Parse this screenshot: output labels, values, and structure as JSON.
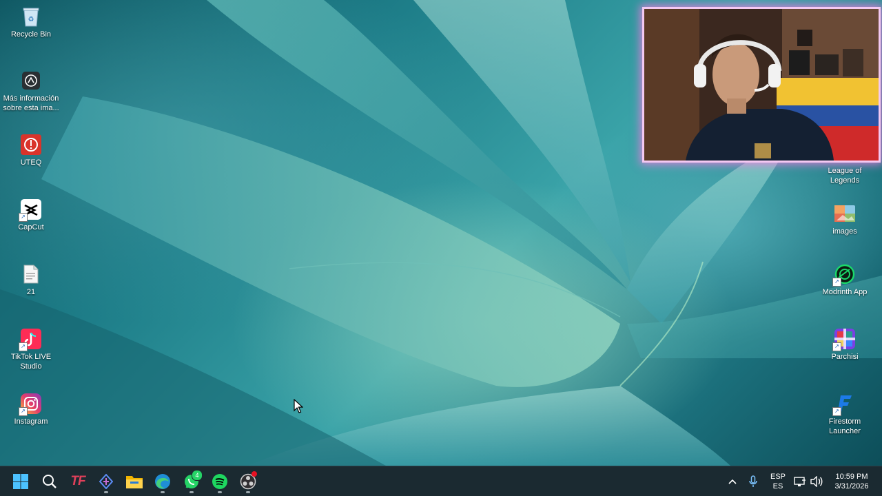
{
  "desktop_icons_left": [
    {
      "name": "recycle-bin",
      "label": "Recycle Bin",
      "icon": "recycle-bin-icon"
    },
    {
      "name": "mas-informacion",
      "label": "Más información sobre esta ima...",
      "icon": "camera-info-icon"
    },
    {
      "name": "uteq",
      "label": "UTEQ",
      "icon": "uteq-icon"
    },
    {
      "name": "capcut",
      "label": "CapCut",
      "icon": "capcut-icon"
    },
    {
      "name": "file-21",
      "label": "21",
      "icon": "document-icon"
    },
    {
      "name": "tiktok-live-studio",
      "label": "TikTok LIVE Studio",
      "icon": "tiktok-icon"
    },
    {
      "name": "instagram",
      "label": "Instagram",
      "icon": "instagram-icon"
    }
  ],
  "desktop_icons_right": [
    {
      "name": "league-of-legends",
      "label": "League of Legends",
      "icon": "league-icon"
    },
    {
      "name": "images",
      "label": "images",
      "icon": "image-icon"
    },
    {
      "name": "modrinth-app",
      "label": "Modrinth App",
      "icon": "modrinth-icon"
    },
    {
      "name": "parchisi",
      "label": "Parchisi",
      "icon": "parchisi-icon"
    },
    {
      "name": "firestorm-launcher",
      "label": "Firestorm Launcher",
      "icon": "firestorm-icon"
    }
  ],
  "taskbar": {
    "apps": [
      {
        "name": "start",
        "icon": "windows-logo-icon"
      },
      {
        "name": "search",
        "icon": "search-icon"
      },
      {
        "name": "tf",
        "label": "TF",
        "icon": "tf-app-icon"
      },
      {
        "name": "dev-app",
        "icon": "dev-app-icon"
      },
      {
        "name": "file-explorer",
        "icon": "folder-icon"
      },
      {
        "name": "edge",
        "icon": "edge-icon"
      },
      {
        "name": "whatsapp",
        "icon": "whatsapp-icon",
        "badge": "4"
      },
      {
        "name": "spotify",
        "icon": "spotify-icon"
      },
      {
        "name": "obs",
        "icon": "obs-icon"
      }
    ],
    "tray": {
      "language_top": "ESP",
      "language_bottom": "ES",
      "time": "10:59 PM",
      "date": "3/31/2026"
    }
  },
  "colors": {
    "taskbar_bg": "#1b2a31",
    "webcam_border": "#f4c9f2",
    "accent": "#4cc2ff"
  }
}
